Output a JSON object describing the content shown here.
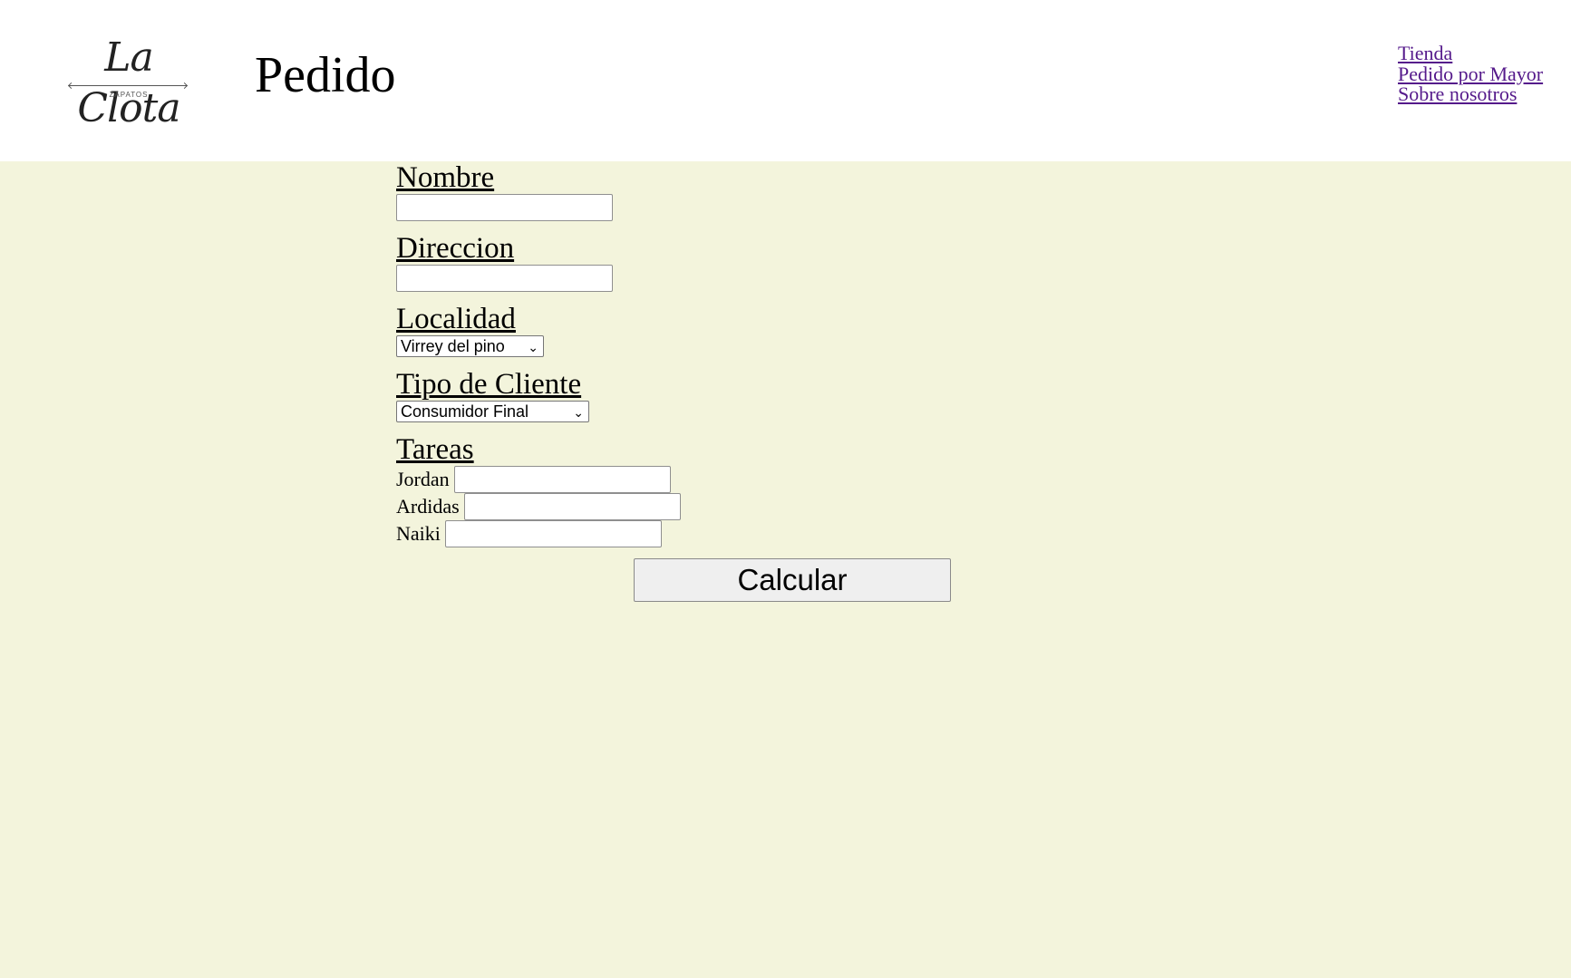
{
  "header": {
    "logo": {
      "name": "La Clota",
      "tagline": "ZAPATOS"
    },
    "title": "Pedido",
    "nav": [
      "Tienda",
      "Pedido por Mayor",
      "Sobre nosotros"
    ]
  },
  "form": {
    "nombre": {
      "label": "Nombre",
      "value": ""
    },
    "direccion": {
      "label": "Direccion",
      "value": ""
    },
    "localidad": {
      "label": "Localidad",
      "selected": "Virrey del pino"
    },
    "tipo_cliente": {
      "label": "Tipo de Cliente",
      "selected": "Consumidor Final"
    },
    "tareas": {
      "label": "Tareas",
      "items": [
        {
          "label": "Jordan",
          "value": ""
        },
        {
          "label": "Ardidas",
          "value": ""
        },
        {
          "label": "Naiki",
          "value": ""
        }
      ]
    },
    "submit_label": "Calcular"
  },
  "colors": {
    "page_background": "#f3f4dc",
    "header_background": "#ffffff",
    "link": "#551a8b"
  },
  "icons": {
    "select_arrow": "chevron-down-icon"
  }
}
